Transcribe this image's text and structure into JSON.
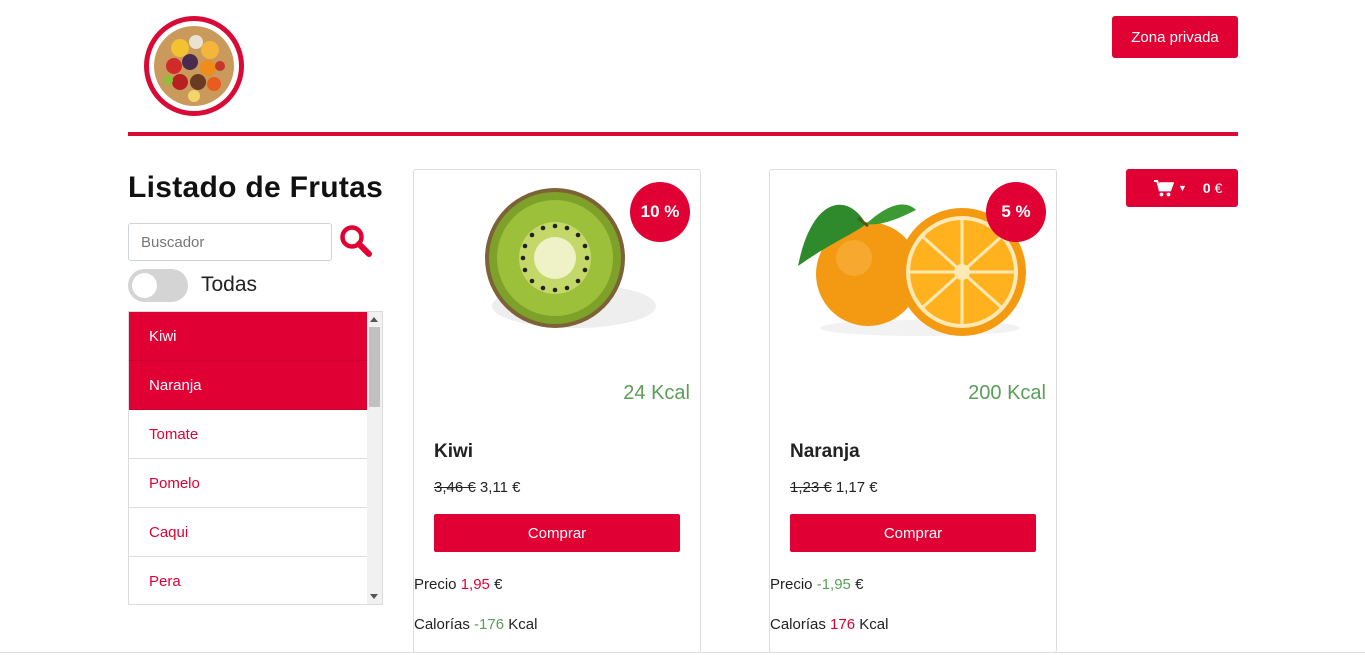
{
  "header": {
    "logo_name": "fruit-bowl-logo",
    "private_button": "Zona privada"
  },
  "cart": {
    "icon": "cart-icon",
    "total": "0",
    "currency": "€"
  },
  "sidebar": {
    "title": "Listado de Frutas",
    "search": {
      "placeholder": "Buscador",
      "value": ""
    },
    "toggle_label": "Todas",
    "toggle_on": false,
    "items": [
      {
        "label": "Kiwi",
        "selected": true
      },
      {
        "label": "Naranja",
        "selected": true
      },
      {
        "label": "Tomate",
        "selected": false
      },
      {
        "label": "Pomelo",
        "selected": false
      },
      {
        "label": "Caqui",
        "selected": false
      },
      {
        "label": "Pera",
        "selected": false
      }
    ]
  },
  "products": [
    {
      "image": "kiwi-image",
      "discount": "10 %",
      "kcal": "24 Kcal",
      "name": "Kiwi",
      "old_price": "3,46 €",
      "new_price": "3,11 €",
      "buy_label": "Comprar",
      "precio_label": "Precio",
      "precio_value": "1,95",
      "precio_unit": "€",
      "calorias_label": "Calorías",
      "calorias_value": "-176",
      "calorias_unit": "Kcal"
    },
    {
      "image": "orange-image",
      "discount": "5 %",
      "kcal": "200 Kcal",
      "name": "Naranja",
      "old_price": "1,23 €",
      "new_price": "1,17 €",
      "buy_label": "Comprar",
      "precio_label": "Precio",
      "precio_value": "-1,95",
      "precio_unit": "€",
      "calorias_label": "Calorías",
      "calorias_value": "176",
      "calorias_unit": "Kcal"
    }
  ],
  "colors": {
    "accent": "#e00034",
    "positive": "#5a9e58",
    "toggle_off": "#d4d4d4"
  }
}
